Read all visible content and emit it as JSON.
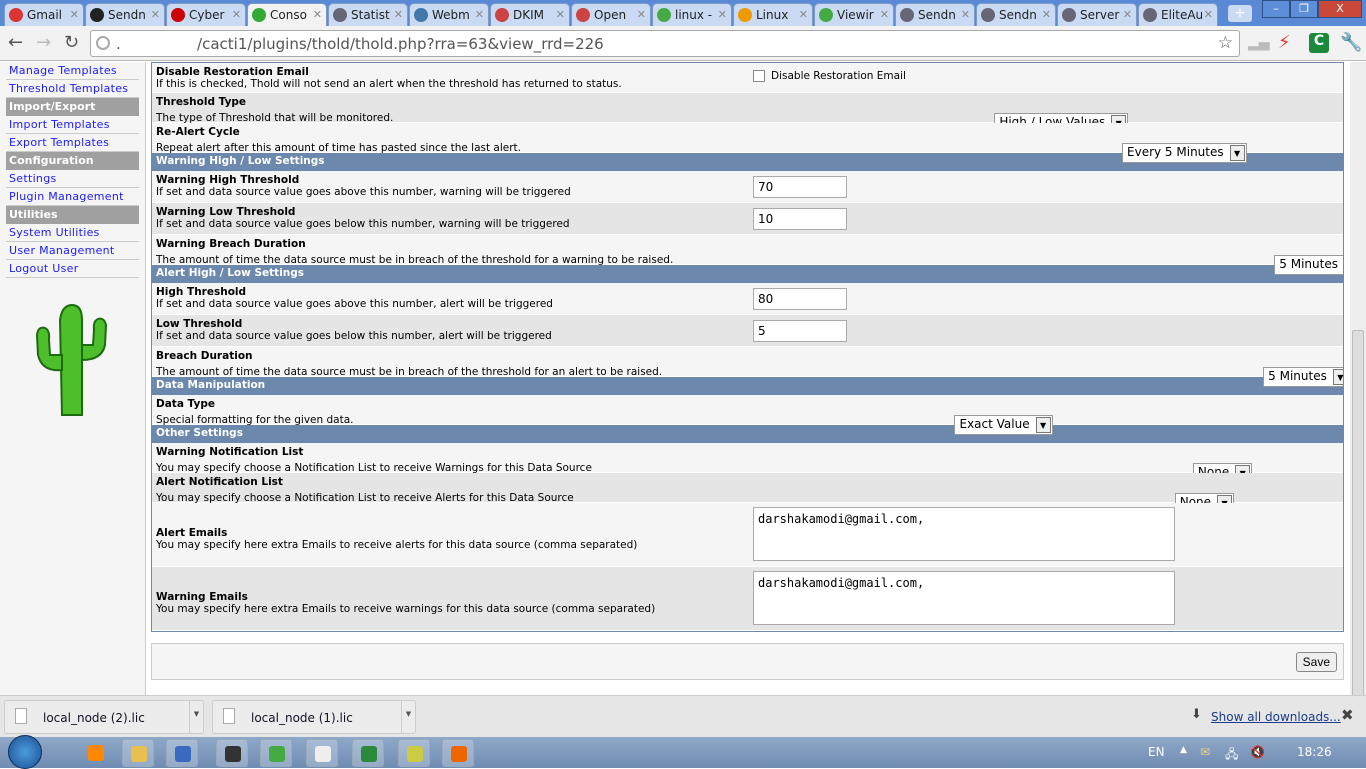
{
  "browser": {
    "tabs": [
      {
        "label": "Gmail",
        "icon": "gmail-icon",
        "color": "#d33"
      },
      {
        "label": "Sendn",
        "icon": "tux-icon",
        "color": "#222"
      },
      {
        "label": "Cyber",
        "icon": "r-logo-icon",
        "color": "#c00"
      },
      {
        "label": "Conso",
        "icon": "cacti-icon",
        "color": "#3a3",
        "active": true
      },
      {
        "label": "Statist",
        "icon": "globe-icon",
        "color": "#667"
      },
      {
        "label": "Webm",
        "icon": "webmin-icon",
        "color": "#47a"
      },
      {
        "label": "DKIM",
        "icon": "page-icon",
        "color": "#c44"
      },
      {
        "label": "Open",
        "icon": "page-icon",
        "color": "#c44"
      },
      {
        "label": "linux -",
        "icon": "google-icon",
        "color": "#4a4"
      },
      {
        "label": "Linux",
        "icon": "page-icon",
        "color": "#e90"
      },
      {
        "label": "Viewir",
        "icon": "google-icon",
        "color": "#4a4"
      },
      {
        "label": "Sendn",
        "icon": "globe-icon",
        "color": "#667"
      },
      {
        "label": "Sendn",
        "icon": "globe-icon",
        "color": "#667"
      },
      {
        "label": "Server",
        "icon": "globe-icon",
        "color": "#667"
      },
      {
        "label": "EliteAu",
        "icon": "globe-icon",
        "color": "#667"
      }
    ],
    "new_tab": "+",
    "url": ".                /cacti1/plugins/thold/thold.php?rra=63&view_rrd=226"
  },
  "sidebar": [
    {
      "type": "item",
      "label": "Manage Templates"
    },
    {
      "type": "item",
      "label": "Threshold Templates"
    },
    {
      "type": "head",
      "label": "Import/Export"
    },
    {
      "type": "item",
      "label": "Import Templates"
    },
    {
      "type": "item",
      "label": "Export Templates"
    },
    {
      "type": "head",
      "label": "Configuration"
    },
    {
      "type": "item",
      "label": "Settings"
    },
    {
      "type": "item",
      "label": "Plugin Management"
    },
    {
      "type": "head",
      "label": "Utilities"
    },
    {
      "type": "item",
      "label": "System Utilities"
    },
    {
      "type": "item",
      "label": "User Management"
    },
    {
      "type": "item",
      "label": "Logout User"
    }
  ],
  "form": [
    {
      "kind": "field",
      "h": 30,
      "title": "Disable Restoration Email",
      "desc": "If this is checked, Thold will not send an alert when the threshold has returned to status.",
      "control": "checkbox",
      "checked": false,
      "label": "Disable Restoration Email"
    },
    {
      "kind": "field",
      "h": 30,
      "title": "Threshold Type",
      "desc": "The type of Threshold that will be monitored.",
      "control": "select",
      "value": "High / Low Values"
    },
    {
      "kind": "field",
      "h": 30,
      "title": "Re-Alert Cycle",
      "desc": "Repeat alert after this amount of time has pasted since the last alert.",
      "control": "select",
      "value": "Every 5 Minutes"
    },
    {
      "kind": "header",
      "label": "Warning High / Low Settings"
    },
    {
      "kind": "field",
      "h": 32,
      "title": "Warning High Threshold",
      "desc": "If set and data source value goes above this number, warning will be triggered",
      "control": "text",
      "value": "70"
    },
    {
      "kind": "field",
      "h": 32,
      "title": "Warning Low Threshold",
      "desc": "If set and data source value goes below this number, warning will be triggered",
      "control": "text",
      "value": "10"
    },
    {
      "kind": "field",
      "h": 30,
      "title": "Warning Breach Duration",
      "desc": "The amount of time the data source must be in breach of the threshold for a warning to be raised.",
      "control": "select",
      "value": "5 Minutes"
    },
    {
      "kind": "header",
      "label": "Alert High / Low Settings"
    },
    {
      "kind": "field",
      "h": 32,
      "title": "High Threshold",
      "desc": "If set and data source value goes above this number, alert will be triggered",
      "control": "text",
      "value": "80"
    },
    {
      "kind": "field",
      "h": 32,
      "title": "Low Threshold",
      "desc": "If set and data source value goes below this number, alert will be triggered",
      "control": "text",
      "value": "5"
    },
    {
      "kind": "field",
      "h": 30,
      "title": "Breach Duration",
      "desc": "The amount of time the data source must be in breach of the threshold for an alert to be raised.",
      "control": "select",
      "value": "5 Minutes"
    },
    {
      "kind": "header",
      "label": "Data Manipulation"
    },
    {
      "kind": "field",
      "h": 30,
      "title": "Data Type",
      "desc": "Special formatting for the given data.",
      "control": "select",
      "value": "Exact Value"
    },
    {
      "kind": "header",
      "label": "Other Settings"
    },
    {
      "kind": "field",
      "h": 30,
      "title": "Warning Notification List",
      "desc": "You may specify choose a Notification List to receive Warnings for this Data Source",
      "control": "select",
      "value": "None"
    },
    {
      "kind": "field",
      "h": 30,
      "title": "Alert Notification List",
      "desc": "You may specify choose a Notification List to receive Alerts for this Data Source",
      "control": "select",
      "value": "None"
    },
    {
      "kind": "field",
      "h": 64,
      "title": "Alert Emails",
      "desc": "You may specify here extra Emails to receive alerts for this data source (comma separated)",
      "control": "textarea",
      "value": "darshakamodi@gmail.com,"
    },
    {
      "kind": "field",
      "h": 64,
      "title": "Warning Emails",
      "desc": "You may specify here extra Emails to receive warnings for this data source (comma separated)",
      "control": "textarea",
      "value": "darshakamodi@gmail.com,"
    }
  ],
  "save_label": "Save",
  "downloads": {
    "items": [
      "local_node (2).lic",
      "local_node (1).lic"
    ],
    "show_all": "Show all downloads..."
  },
  "taskbar": {
    "language": "EN",
    "clock": "18:26",
    "apps": [
      "media-player-icon",
      "explorer-icon",
      "network-icon",
      "terminal-icon",
      "chrome-icon",
      "document-icon",
      "excel-icon",
      "notepad-icon",
      "firefox-icon"
    ]
  },
  "colors": {
    "section_header": "#6d88ad",
    "link": "#1a1aff",
    "sidebar_header": "#a0a0a0"
  }
}
